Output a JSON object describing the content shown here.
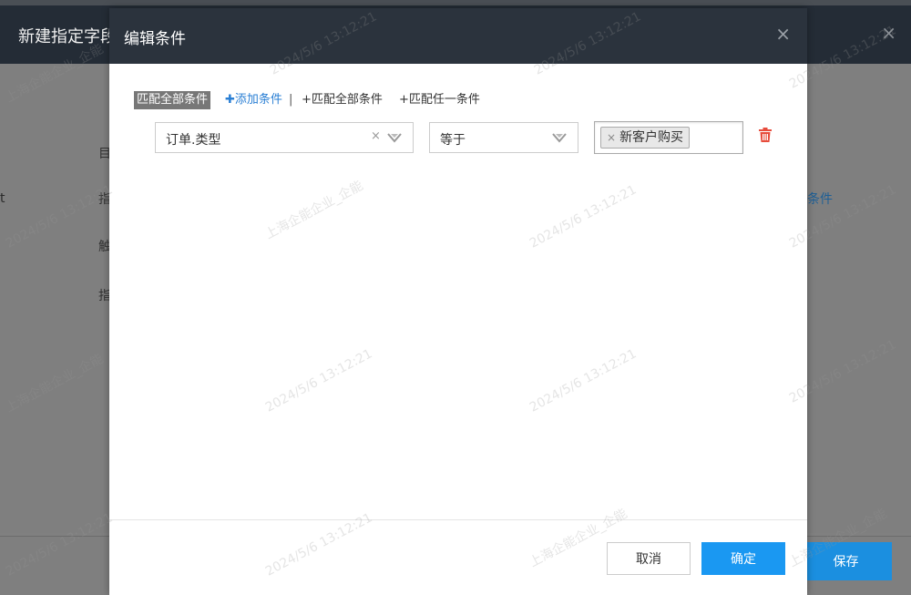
{
  "background_dialog": {
    "title": "新建指定字段",
    "close_icon": "×",
    "labels": [
      "目",
      "指",
      "触",
      "指"
    ],
    "edge_text": "t",
    "link_partial": "条件",
    "save_button": "保存"
  },
  "modal": {
    "title": "编辑条件",
    "close_icon": "×",
    "toolbar": {
      "match_tag": "匹配全部条件",
      "add_condition": "添加条件",
      "separator": "|",
      "match_all": "+匹配全部条件",
      "match_any": "+匹配任一条件"
    },
    "condition": {
      "field_value": "订单.类型",
      "field_clear": "×",
      "operator_value": "等于",
      "chip_remove": "×",
      "chip_label": "新客户购买"
    },
    "footer": {
      "cancel": "取消",
      "confirm": "确定"
    }
  },
  "watermark": {
    "date": "2024/5/6 13:12:21",
    "company": "上海企能企业_企能"
  },
  "colors": {
    "header_dark": "#2b333d",
    "primary_blue": "#1a98f2",
    "link_blue": "#2a7fd4",
    "delete_red": "#e74c3c"
  }
}
